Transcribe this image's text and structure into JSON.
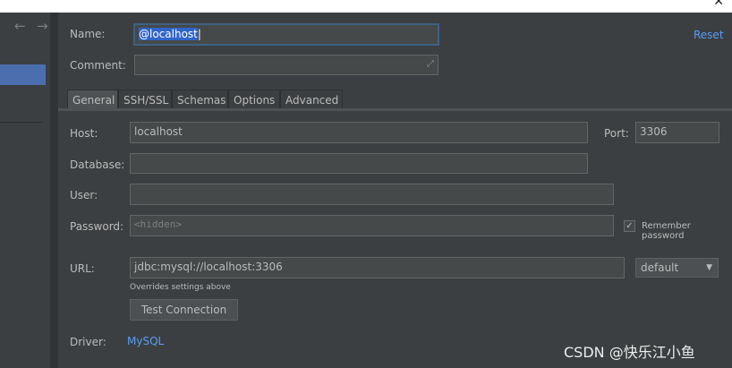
{
  "form": {
    "name_label": "Name:",
    "name_value": "@localhost",
    "reset_link": "Reset",
    "comment_label": "Comment:",
    "comment_value": "",
    "tabs": [
      "General",
      "SSH/SSL",
      "Schemas",
      "Options",
      "Advanced"
    ],
    "active_tab": "General",
    "host_label": "Host:",
    "host_value": "localhost",
    "port_label": "Port:",
    "port_value": "3306",
    "database_label": "Database:",
    "database_value": "",
    "user_label": "User:",
    "user_value": "",
    "password_label": "Password:",
    "password_placeholder": "<hidden>",
    "remember_password_label": "Remember password",
    "remember_password_checked": true,
    "url_label": "URL:",
    "url_value": "jdbc:mysql://localhost:3306",
    "url_driver_option": "default",
    "url_note": "Overrides settings above",
    "test_connection_button": "Test Connection",
    "driver_label": "Driver:",
    "driver_value": "MySQL"
  },
  "window": {
    "close_glyph": "✕",
    "back_glyph": "←",
    "forward_glyph": "→"
  },
  "watermark": "CSDN @快乐江小鱼",
  "colors": {
    "background": "#3c3f41",
    "selection": "#4b6eaf",
    "link": "#589df6",
    "focus_border": "#3d6185",
    "text_highlight": "#2f65ca"
  }
}
